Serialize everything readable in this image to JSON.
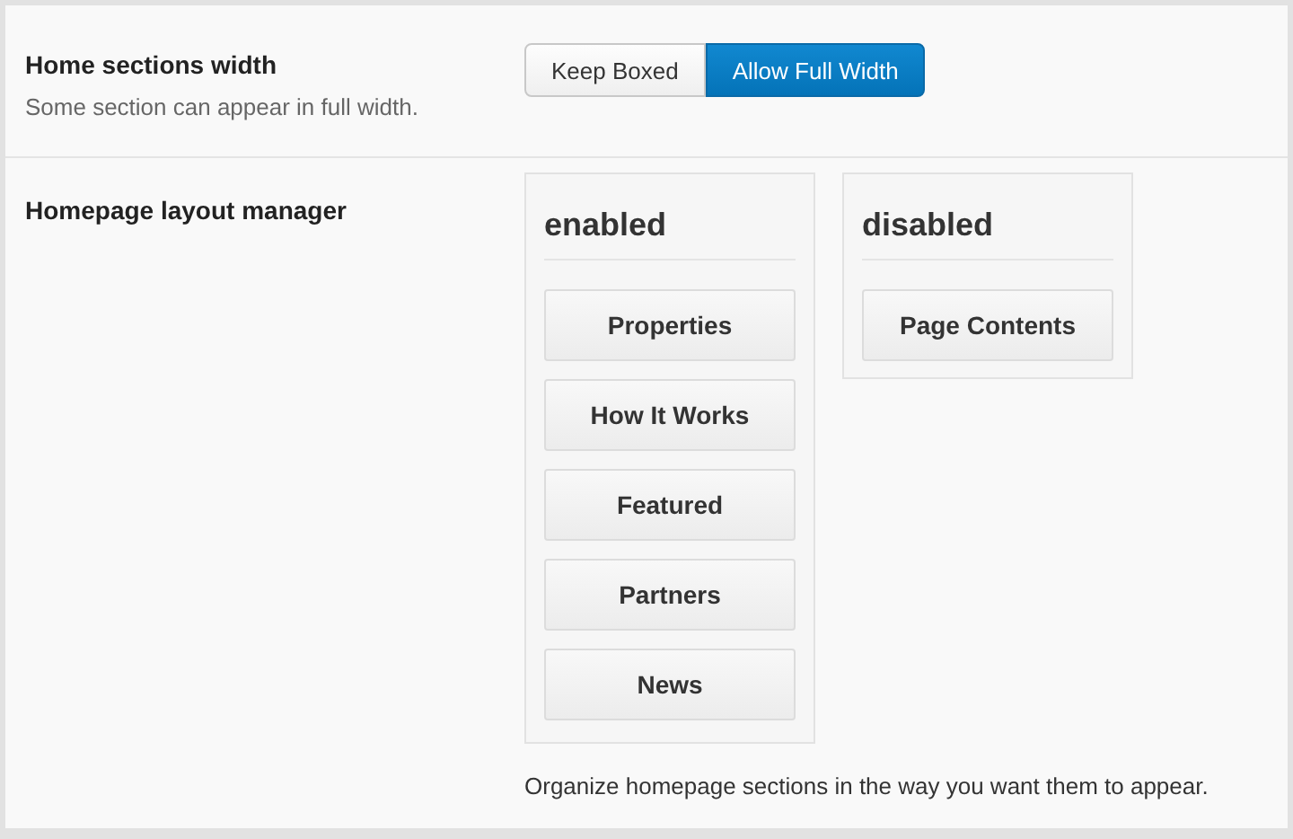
{
  "width_setting": {
    "label": "Home sections width",
    "description": "Some section can appear in full width.",
    "options": [
      {
        "label": "Keep Boxed",
        "selected": false
      },
      {
        "label": "Allow Full Width",
        "selected": true
      }
    ]
  },
  "layout_manager": {
    "label": "Homepage layout manager",
    "columns": [
      {
        "title": "enabled",
        "items": [
          "Properties",
          "How It Works",
          "Featured",
          "Partners",
          "News"
        ]
      },
      {
        "title": "disabled",
        "items": [
          "Page Contents"
        ]
      }
    ],
    "description": "Organize homepage sections in the way you want them to appear."
  }
}
